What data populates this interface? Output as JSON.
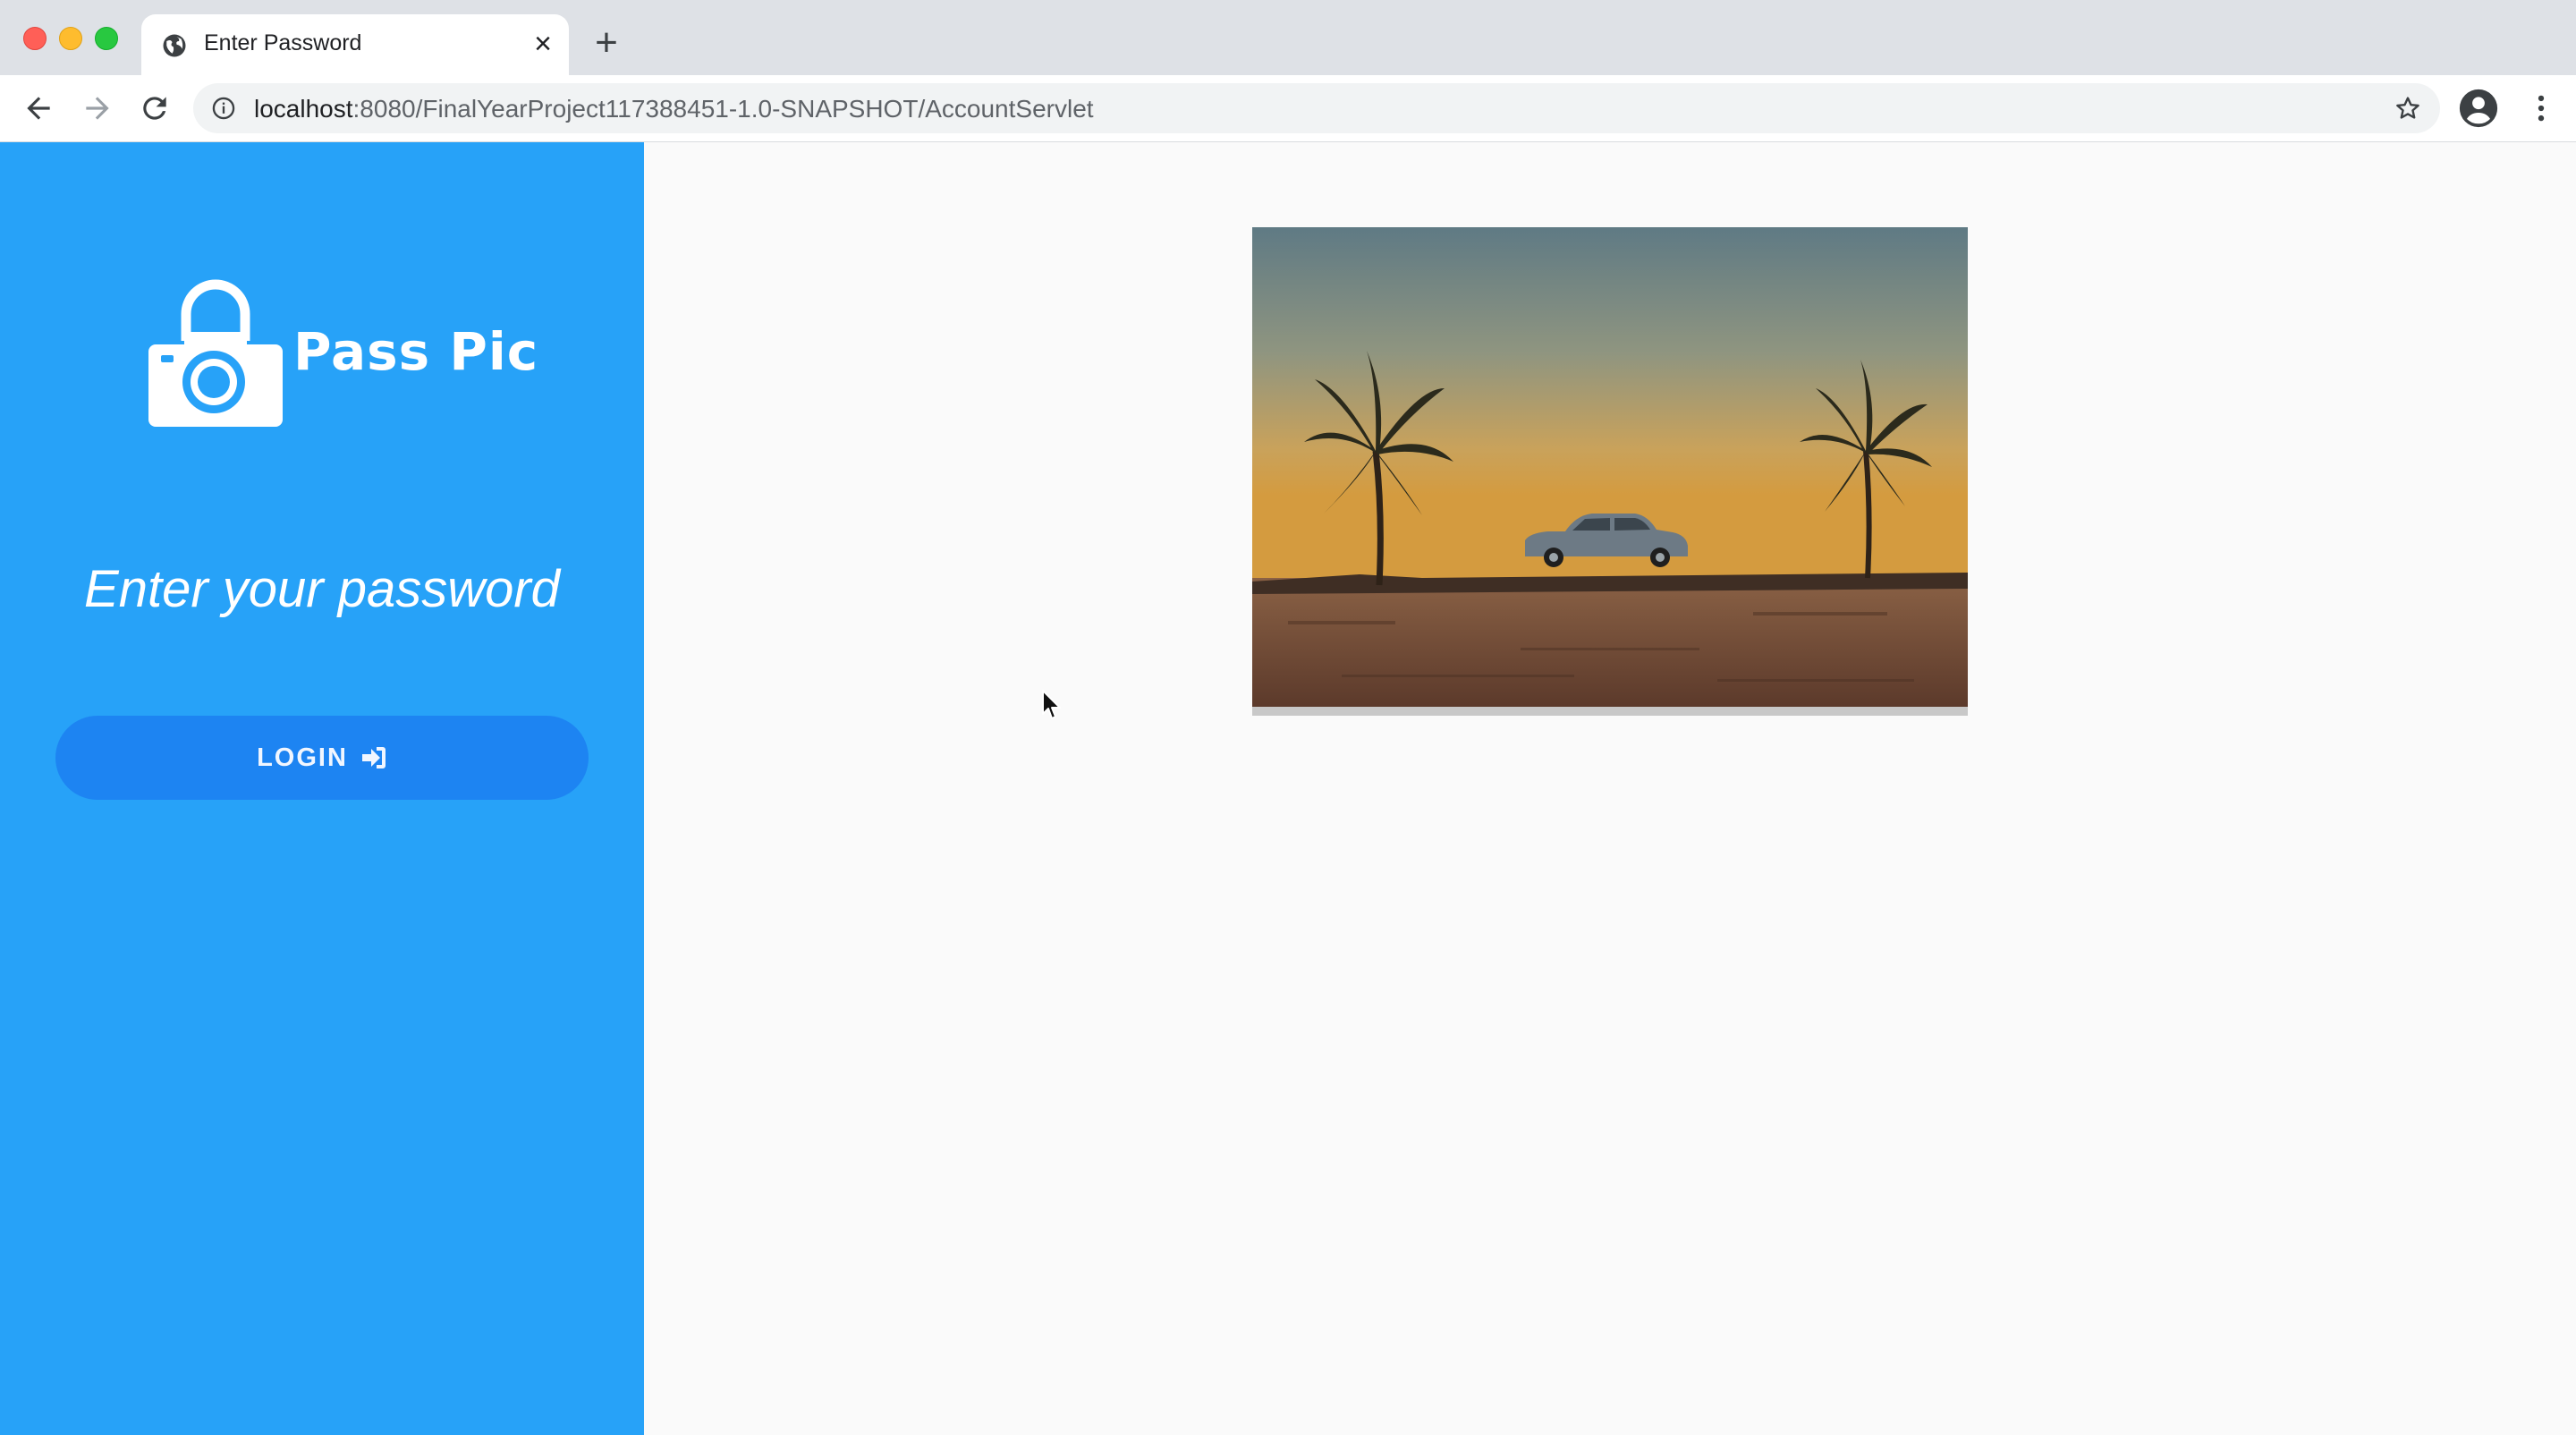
{
  "browser": {
    "tab_title": "Enter Password",
    "tab_close": "×",
    "new_tab": "+",
    "url_host": "localhost",
    "url_path": ":8080/FinalYearProject117388451-1.0-SNAPSHOT/AccountServlet"
  },
  "sidebar": {
    "brand": "Pass Pic",
    "prompt": "Enter your password",
    "login_label": "LOGIN"
  },
  "icons": {
    "globe": "globe-icon",
    "back": "arrow-left-icon",
    "forward": "arrow-right-icon",
    "reload": "reload-icon",
    "info": "info-icon",
    "star": "star-icon",
    "profile": "profile-icon",
    "menu": "kebab-menu-icon",
    "logo": "padlock-camera-icon",
    "login": "sign-in-icon",
    "cursor": "mouse-cursor-icon"
  },
  "colors": {
    "sidebar": "#27a2f8",
    "login_button": "#1d84f2",
    "content_bg": "#fafafa"
  }
}
